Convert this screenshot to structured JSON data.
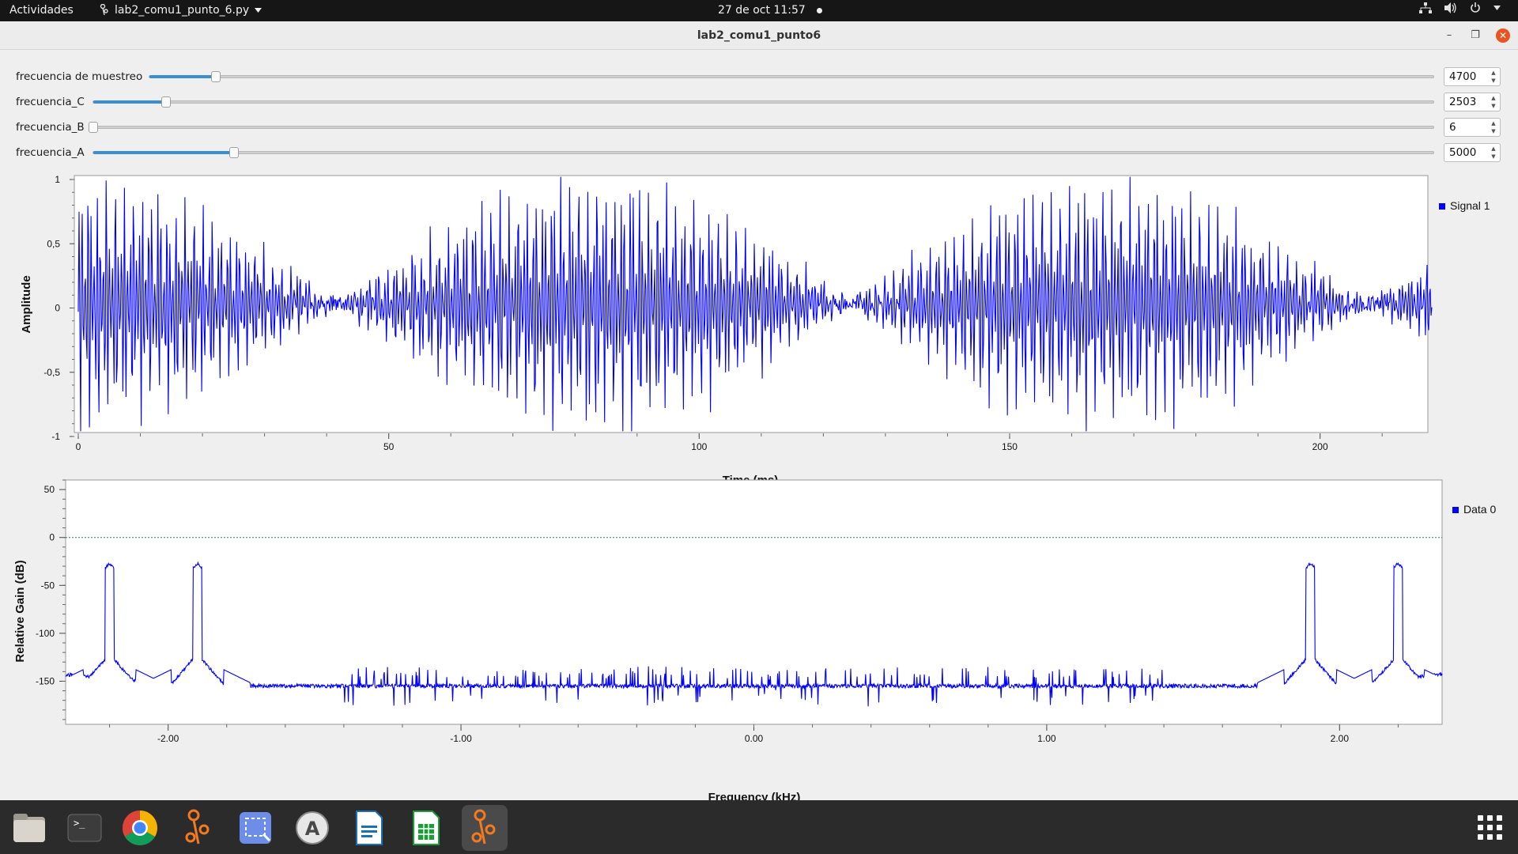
{
  "topbar": {
    "activities": "Actividades",
    "app_menu": "lab2_comu1_punto_6.py",
    "clock": "27 de oct  11:57"
  },
  "window": {
    "title": "lab2_comu1_punto6"
  },
  "controls": [
    {
      "label": "frecuencia de muestreo",
      "value": "4700",
      "level": 0.052
    },
    {
      "label": "frecuencia_C",
      "value": "2503",
      "level": 0.054
    },
    {
      "label": "frecuencia_B",
      "value": "6",
      "level": 0.0
    },
    {
      "label": "frecuencia_A",
      "value": "5000",
      "level": 0.105
    }
  ],
  "time_plot": {
    "ylabel": "Amplitude",
    "xlabel": "Time (ms)",
    "legend": "Signal 1",
    "y_ticks": [
      "1",
      "0,5",
      "0",
      "-0,5",
      "-1"
    ],
    "x_ticks": [
      "0",
      "50",
      "100",
      "150",
      "200"
    ]
  },
  "freq_plot": {
    "ylabel": "Relative Gain (dB)",
    "xlabel": "Frequency (kHz)",
    "legend": "Data 0",
    "y_ticks": [
      "50",
      "0",
      "-50",
      "-100",
      "-150"
    ],
    "x_ticks": [
      "-2.00",
      "-1.00",
      "0.00",
      "1.00",
      "2.00"
    ]
  },
  "chart_data": [
    {
      "type": "line",
      "title": "",
      "xlabel": "Time (ms)",
      "ylabel": "Amplitude",
      "xlim": [
        0,
        218
      ],
      "ylim": [
        -1,
        1
      ],
      "series": [
        {
          "name": "Signal 1",
          "color": "#0000ff"
        }
      ],
      "envelope_peaks_ms": [
        0,
        83,
        165
      ],
      "envelope_nulls_ms": [
        42,
        125,
        208
      ],
      "carrier_khz": 0.3
    },
    {
      "type": "line",
      "title": "",
      "xlabel": "Frequency (kHz)",
      "ylabel": "Relative Gain (dB)",
      "xlim": [
        -2.35,
        2.35
      ],
      "ylim": [
        -195,
        60
      ],
      "series": [
        {
          "name": "Data 0",
          "color": "#0000ff"
        }
      ],
      "peaks_khz": [
        -2.2,
        -1.9,
        1.9,
        2.2
      ],
      "peak_db": -27,
      "noise_floor_db": -160,
      "reference_line_db": 0
    }
  ],
  "dock": [
    "files-icon",
    "terminal-icon",
    "chrome-icon",
    "gnuradio-icon",
    "screenshot-icon",
    "software-icon",
    "writer-icon",
    "calc-icon",
    "gnuradio-icon",
    "apps-grid-icon"
  ]
}
